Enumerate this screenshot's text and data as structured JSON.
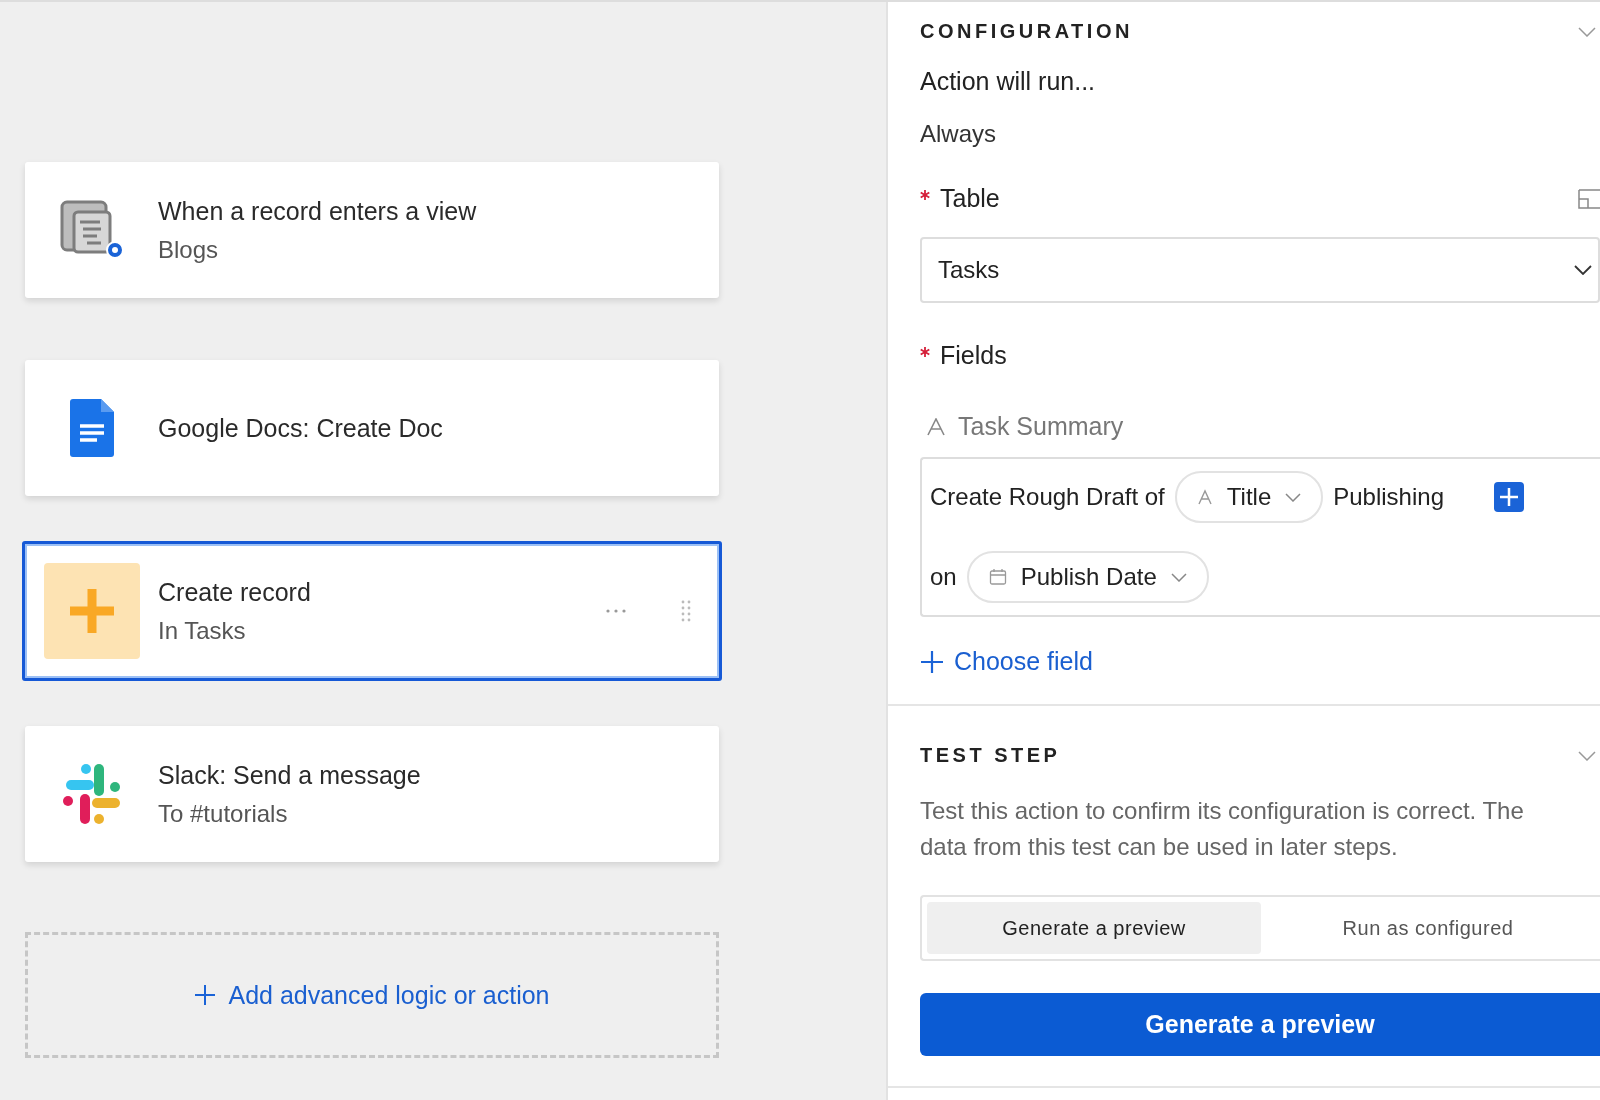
{
  "steps": [
    {
      "kind": "trigger",
      "title": "When a record enters a view",
      "subtitle": "Blogs",
      "selected": false
    },
    {
      "kind": "docs",
      "title": "Google Docs: Create Doc",
      "selected": false
    },
    {
      "kind": "create",
      "title": "Create record",
      "subtitle": "In Tasks",
      "selected": true
    },
    {
      "kind": "slack",
      "title": "Slack: Send a message",
      "subtitle": "To #tutorials",
      "selected": false
    }
  ],
  "add_action": {
    "label": "Add advanced logic or action"
  },
  "configuration": {
    "heading": "CONFIGURATION",
    "run_label": "Action will run...",
    "run_value": "Always",
    "table": {
      "label": "Table",
      "required": true,
      "value": "Tasks"
    },
    "fields": {
      "label": "Fields",
      "required": true,
      "items": [
        {
          "name": "Task Summary",
          "parts": [
            {
              "kind": "text",
              "text": "Create Rough Draft of"
            },
            {
              "kind": "text_pill",
              "label": "Title"
            },
            {
              "kind": "text",
              "text": "Publishing"
            },
            {
              "kind": "text",
              "text": "on"
            },
            {
              "kind": "date_pill",
              "label": "Publish Date"
            }
          ]
        }
      ]
    },
    "choose_field": "Choose field"
  },
  "test_step": {
    "heading": "TEST STEP",
    "description": "Test this action to confirm its configuration is correct. The data from this test can be used in later steps.",
    "modes": [
      {
        "label": "Generate a preview",
        "selected": true
      },
      {
        "label": "Run as configured",
        "selected": false
      }
    ],
    "button": "Generate a preview"
  }
}
